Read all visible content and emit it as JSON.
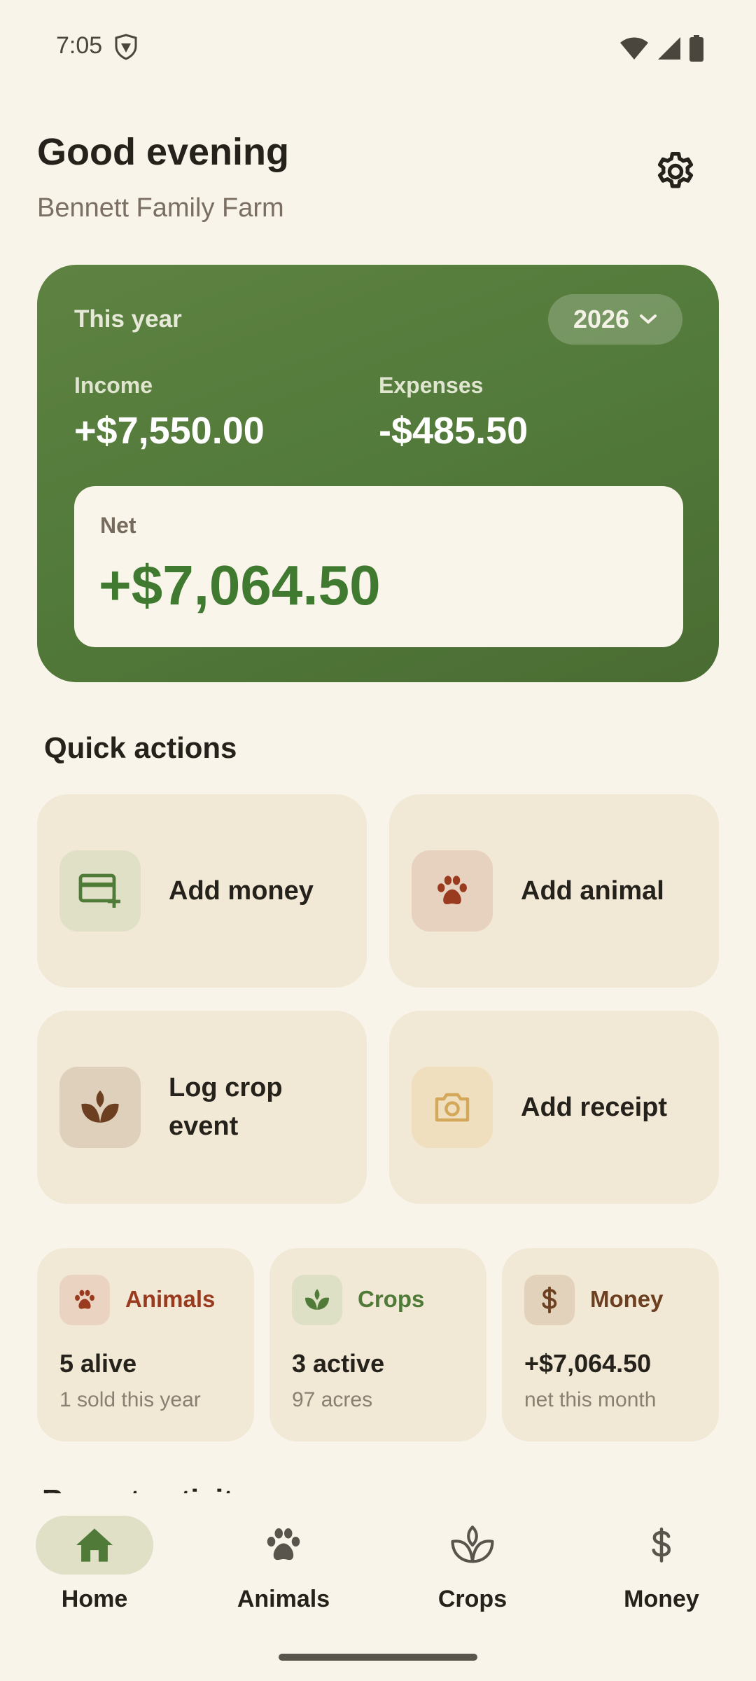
{
  "status_bar": {
    "time": "7:05"
  },
  "header": {
    "greeting": "Good evening",
    "farm_name": "Bennett Family Farm"
  },
  "summary": {
    "period_label": "This year",
    "year": "2026",
    "income_label": "Income",
    "income_value": "+$7,550.00",
    "expenses_label": "Expenses",
    "expenses_value": "-$485.50",
    "net_label": "Net",
    "net_value": "+$7,064.50"
  },
  "quick_actions": {
    "title": "Quick actions",
    "items": [
      {
        "label": "Add money",
        "icon": "card-add-icon"
      },
      {
        "label": "Add animal",
        "icon": "paw-icon"
      },
      {
        "label": "Log crop event",
        "icon": "sprout-icon"
      },
      {
        "label": "Add receipt",
        "icon": "camera-icon"
      }
    ]
  },
  "stats": [
    {
      "name": "Animals",
      "value": "5 alive",
      "sub": "1 sold this year",
      "color": "#9a3b1f"
    },
    {
      "name": "Crops",
      "value": "3 active",
      "sub": "97 acres",
      "color": "#4f7a38"
    },
    {
      "name": "Money",
      "value": "+$7,064.50",
      "sub": "net this month",
      "color": "#6b3f1f"
    }
  ],
  "recent_peek": "Recent activity",
  "nav": {
    "items": [
      {
        "label": "Home",
        "active": true
      },
      {
        "label": "Animals"
      },
      {
        "label": "Crops"
      },
      {
        "label": "Money"
      }
    ]
  },
  "colors": {
    "background": "#f8f4ea",
    "card_green": "#557b3c",
    "accent_green": "#3f7a30",
    "tile": "#f1e8d6"
  }
}
